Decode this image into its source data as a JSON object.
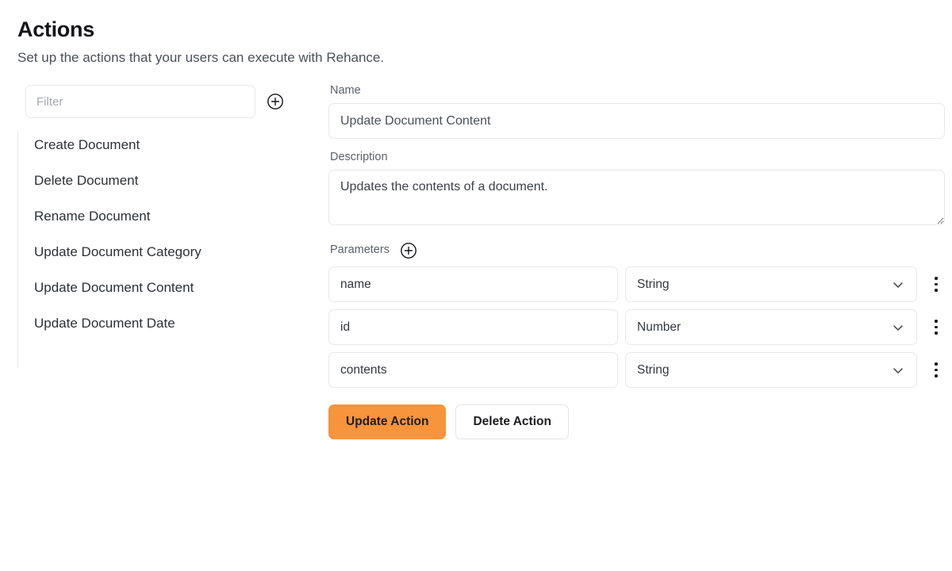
{
  "header": {
    "title": "Actions",
    "subtitle": "Set up the actions that your users can execute with Rehance."
  },
  "sidebar": {
    "filter": {
      "placeholder": "Filter",
      "value": ""
    },
    "add_icon": "plus-circle-icon",
    "items": [
      {
        "label": "Create Document"
      },
      {
        "label": "Delete Document"
      },
      {
        "label": "Rename Document"
      },
      {
        "label": "Update Document Category"
      },
      {
        "label": "Update Document Content"
      },
      {
        "label": "Update Document Date"
      }
    ]
  },
  "detail": {
    "name": {
      "label": "Name",
      "value": "Update Document Content",
      "placeholder": "Name"
    },
    "description": {
      "label": "Description",
      "value": "Updates the contents of a document.",
      "placeholder": "Description"
    },
    "parameters": {
      "label": "Parameters",
      "add_icon": "plus-circle-icon",
      "menu_icon": "kebab-menu-icon",
      "chevron_icon": "chevron-down-icon",
      "rows": [
        {
          "name": "name",
          "type": "String"
        },
        {
          "name": "id",
          "type": "Number"
        },
        {
          "name": "contents",
          "type": "String"
        }
      ]
    },
    "buttons": {
      "update_label": "Update Action",
      "delete_label": "Delete Action"
    }
  },
  "colors": {
    "accent": "#f7943c",
    "border": "#e6e8eb",
    "text": "#2c3038",
    "muted": "#5b616b"
  }
}
